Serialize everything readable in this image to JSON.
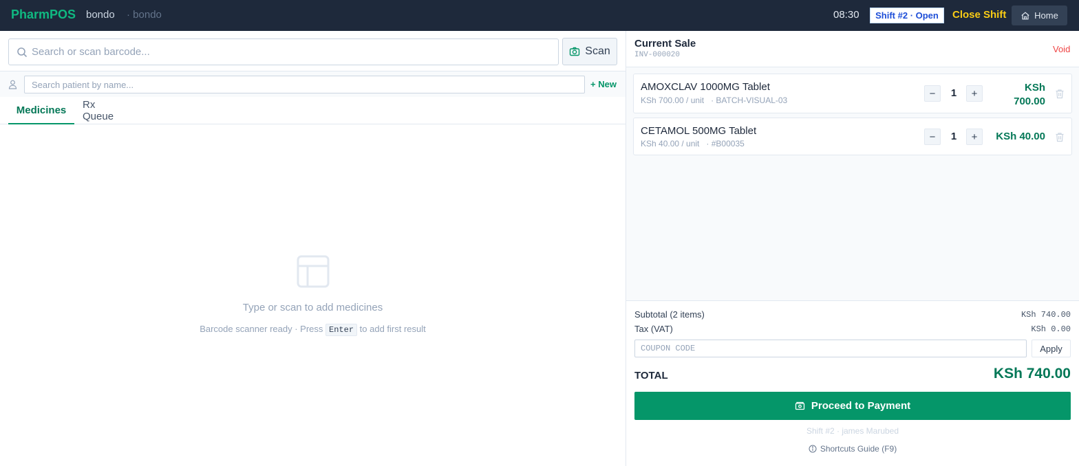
{
  "header": {
    "brand": "PharmPOS",
    "store": "bondo",
    "branch": "· bondo",
    "time": "08:30",
    "shift_badge": "Shift #2 · Open",
    "close_shift": "Close Shift",
    "home": "Home"
  },
  "search": {
    "placeholder": "Search or scan barcode...",
    "scan_label": "Scan"
  },
  "patient": {
    "placeholder": "Search patient by name...",
    "new_label": "+ New"
  },
  "tabs": [
    {
      "label": "Medicines",
      "active": true
    },
    {
      "label": "Rx Queue",
      "active": false
    }
  ],
  "empty_state": {
    "title": "Type or scan to add medicines",
    "hint_before": "Barcode scanner ready · Press",
    "hint_key": "Enter",
    "hint_after": "to add first result"
  },
  "sale": {
    "title": "Current Sale",
    "invoice": "INV-000020",
    "void_label": "Void",
    "items": [
      {
        "name": "AMOXCLAV 1000MG Tablet",
        "unit_price": "KSh 700.00 / unit",
        "batch": "· BATCH-VISUAL-03",
        "qty": "1",
        "total_line1": "KSh",
        "total_line2": "700.00"
      },
      {
        "name": "CETAMOL 500MG Tablet",
        "unit_price": "KSh 40.00 / unit",
        "batch": "· #B00035",
        "qty": "1",
        "total": "KSh 40.00"
      }
    ]
  },
  "summary": {
    "subtotal_label": "Subtotal (2 items)",
    "subtotal_value": "KSh 740.00",
    "tax_label": "Tax (VAT)",
    "tax_value": "KSh 0.00",
    "coupon_placeholder": "COUPON CODE",
    "apply_label": "Apply",
    "total_label": "TOTAL",
    "total_value": "KSh 740.00",
    "pay_label": "Proceed to Payment",
    "shift_info": "Shift #2 · james Marubed",
    "shortcuts": "Shortcuts Guide (F9)"
  },
  "colors": {
    "topbar": "#1e293b",
    "brand": "#10b981",
    "accent": "#059669",
    "close_shift": "#facc15",
    "void": "#ef4444"
  },
  "icons": [
    "search-icon",
    "camera-icon",
    "user-icon",
    "home-icon",
    "table-icon",
    "trash-icon",
    "wallet-icon",
    "info-icon"
  ]
}
